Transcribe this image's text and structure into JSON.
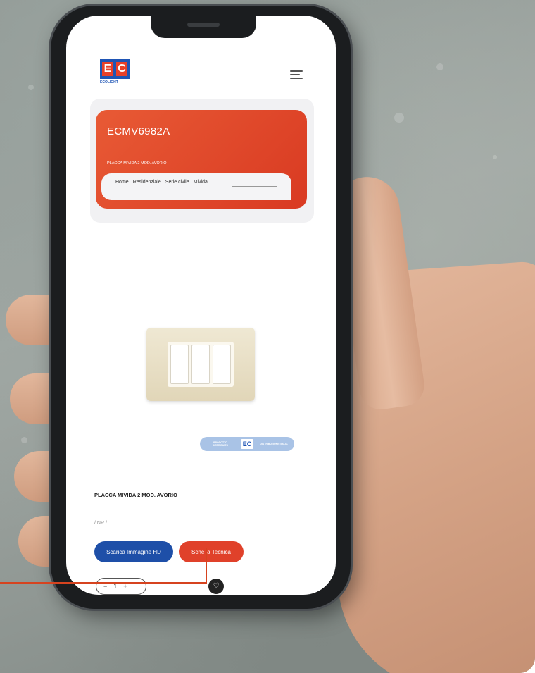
{
  "header": {
    "logo_text": "EC",
    "logo_sub": "ECOLIGHT"
  },
  "hero": {
    "code": "ECMV6982A",
    "description": "PLACCA MIVIDA 2 MOD. AVORIO",
    "breadcrumb": [
      "Home",
      "Residenziale",
      "Serie civile",
      "Mivida"
    ]
  },
  "badge": {
    "left_text": "PRODOTTO DISTRIBUITO",
    "logo": "EC",
    "right_text": "DISTRIBUZIONE ITALIA"
  },
  "product": {
    "name": "PLACCA MIVIDA 2 MOD. AVORIO",
    "code_label": "/ NR /"
  },
  "actions": {
    "download_image": "Scarica Immagine HD",
    "tech_sheet": "Sche la Tecnica"
  },
  "quantity": {
    "minus": "−",
    "value": "1",
    "plus": "+"
  },
  "icons": {
    "menu": "menu-icon",
    "favorite": "heart-icon"
  },
  "colors": {
    "brand_red": "#e0412a",
    "brand_blue": "#1e4fa8"
  }
}
